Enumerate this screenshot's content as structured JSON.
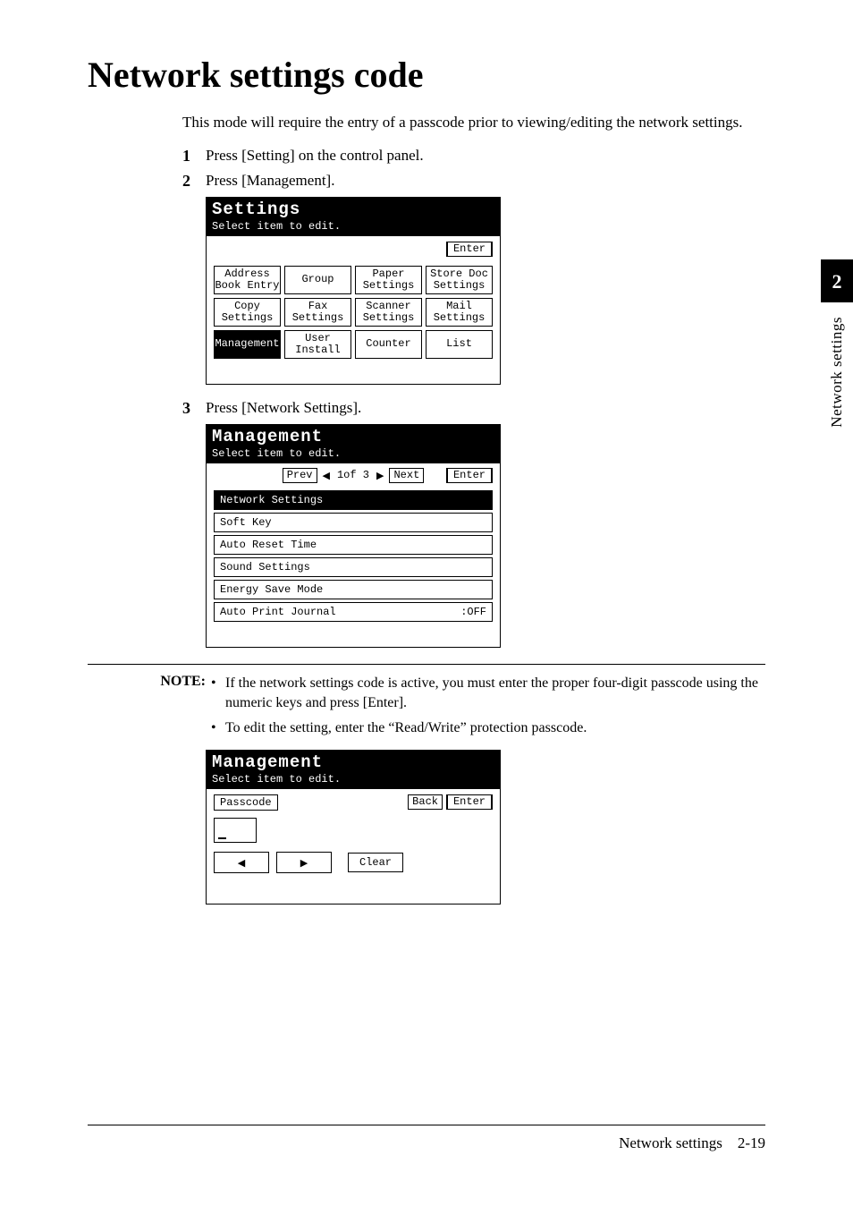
{
  "title": "Network settings code",
  "intro": "This mode will require the entry of a passcode prior to viewing/editing the network settings.",
  "steps": {
    "s1": "Press [Setting] on the control panel.",
    "s2": "Press [Management].",
    "s3": "Press [Network Settings]."
  },
  "lcd1": {
    "title": "Settings",
    "subtitle": "Select item to edit.",
    "enter": "Enter",
    "cells": [
      "Address\nBook Entry",
      "Group",
      "Paper\nSettings",
      "Store Doc\nSettings",
      "Copy\nSettings",
      "Fax\nSettings",
      "Scanner\nSettings",
      "Mail\nSettings",
      "Management",
      "User\nInstall",
      "Counter",
      "List"
    ],
    "selected_index": 8
  },
  "lcd2": {
    "title": "Management",
    "subtitle": "Select item to edit.",
    "prev": "Prev",
    "next": "Next",
    "enter": "Enter",
    "page_indicator": "1of  3",
    "rows": [
      {
        "label": "Network Settings",
        "value": "",
        "selected": true
      },
      {
        "label": "Soft Key",
        "value": "",
        "selected": false
      },
      {
        "label": "Auto Reset Time",
        "value": "",
        "selected": false
      },
      {
        "label": "Sound Settings",
        "value": "",
        "selected": false
      },
      {
        "label": "Energy Save Mode",
        "value": "",
        "selected": false
      },
      {
        "label": "Auto Print Journal",
        "value": ":OFF",
        "selected": false
      }
    ]
  },
  "note": {
    "label": "NOTE:",
    "items": [
      "If the network settings code is active, you must enter the proper four-digit passcode using the numeric keys and press [Enter].",
      "To edit the setting, enter the “Read/Write” protection passcode."
    ]
  },
  "lcd3": {
    "title": "Management",
    "subtitle": "Select item to edit.",
    "passcode_label": "Passcode",
    "back": "Back",
    "enter": "Enter",
    "clear": "Clear"
  },
  "side": {
    "chapter": "2",
    "label": "Network settings"
  },
  "footer": {
    "section": "Network settings",
    "page": "2-19"
  },
  "glyphs": {
    "tri_left": "◀",
    "tri_right": "▶"
  }
}
